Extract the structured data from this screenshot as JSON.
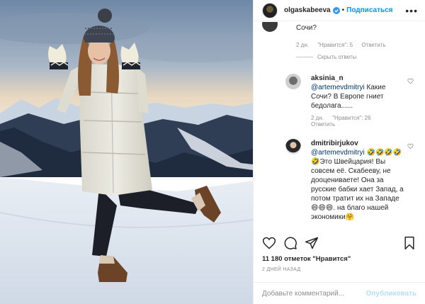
{
  "post": {
    "username": "olgaskabeeva",
    "follow_label": "Подписаться",
    "dot": "•",
    "more": "•••"
  },
  "top_comment": {
    "text_tail": "Сочи?",
    "time": "2 дн.",
    "likes": "\"Нравится\": 5",
    "reply": "Ответить",
    "hide_replies": "Скрыть ответы"
  },
  "replies": [
    {
      "username": "aksinia_n",
      "mention": "@artemevdmitryi",
      "text": "Какие Сочи? В Европе гниет бедолага......",
      "time": "2 дн.",
      "likes": "\"Нравится\": 26",
      "reply": "Ответить"
    },
    {
      "username": "dmitribirjukov",
      "mention": "@artemevdmitryi",
      "text_a": " 🤣🤣🤣🤣🤣Это Швейцария! Вы совсем её. Скабееву, не дооцениваете! Она за русские бабки хает Запад, а потом тратит их на Западе",
      "text_b": "😄😄😄",
      "text_c": ". на благо нашей экономики",
      "text_d": "🤗"
    }
  ],
  "actions": {
    "likes_count": "11 180 отметок \"Нравится\"",
    "date": "2 ДНЕЙ НАЗАД"
  },
  "comment_box": {
    "placeholder": "Добавьте комментарий...",
    "publish": "Опубликовать"
  },
  "icons": [
    "verified-icon",
    "heart-icon",
    "comment-icon",
    "share-icon",
    "bookmark-icon",
    "more-icon"
  ],
  "colors": {
    "link": "#0095f6",
    "mention": "#00376b",
    "muted": "#8e8e8e",
    "publish_disabled": "#b2dffc"
  }
}
